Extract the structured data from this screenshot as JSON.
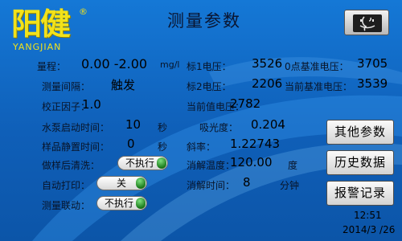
{
  "logo": {
    "cn": "阳健",
    "reg": "®",
    "en": "YANGJIAN"
  },
  "title": "测量参数",
  "home_icon": "mac-finder-icon",
  "fields": {
    "range_label": "量程：",
    "range_value": "0.00 -2.00",
    "range_unit": "mg/l",
    "interval_label": "测量间隔：",
    "interval_value": "触发",
    "factor_label": "校正因子：",
    "factor_value": "1.0",
    "pump_label": "水泵启动时间：",
    "pump_value": "10",
    "pump_unit": "秒",
    "settle_label": "样品静置时间：",
    "settle_value": "0",
    "settle_unit": "秒",
    "clean_label": "做样后清洗：",
    "print_label": "自动打印：",
    "link_label": "测量联动：",
    "std1_label": "标1电压：",
    "std1_value": "3526",
    "std2_label": "标2电压：",
    "std2_value": "2206",
    "cur_label": "当前值电压：",
    "cur_value": "2782",
    "abs_label": "吸光度：",
    "abs_value": "0.204",
    "slope_label": "斜率：",
    "slope_value": "1.22743",
    "temp_label": "消解温度：",
    "temp_value": "120.00",
    "temp_unit": "度",
    "time_label": "消解时间：",
    "time_value": "8",
    "time_unit": "分钟",
    "zero_label": "0点基准电压：",
    "zero_value": "3705",
    "curref_label": "当前基准电压：",
    "curref_value": "3539"
  },
  "toggles": {
    "clean": "不执行",
    "print": "关",
    "link": "不执行"
  },
  "buttons": {
    "other": "其他参数",
    "history": "历史数据",
    "alarm": "报警记录"
  },
  "clock": {
    "time": "12:51",
    "date": "2014/3 /26"
  },
  "colors": {
    "background": "#1578d6",
    "logo": "#f2e21a",
    "knob": "#1a7a1a"
  }
}
